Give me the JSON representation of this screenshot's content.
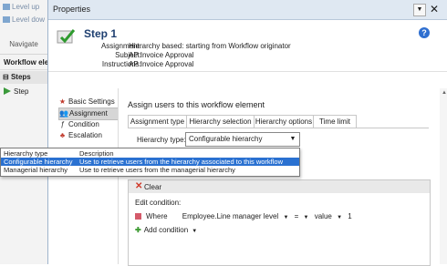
{
  "background_app": {
    "level_up": "Level up",
    "level_down": "Level dow",
    "navigate": "Navigate",
    "workflow_elements": "Workflow ele",
    "steps": "Steps",
    "step_item": "Step"
  },
  "dialog": {
    "title": "Properties",
    "header": {
      "step_title": "Step 1",
      "assignment_label": "Assignment:",
      "assignment_value": "Hierarchy based: starting from Workflow originator",
      "subject_label": "Subject:",
      "subject_value": "AP Invoice Approval",
      "instructions_label": "Instructions:",
      "instructions_value": "AP Invoice Approval"
    },
    "nav": [
      {
        "label": "Basic Settings"
      },
      {
        "label": "Assignment"
      },
      {
        "label": "Condition"
      },
      {
        "label": "Escalation"
      }
    ],
    "content": {
      "title": "Assign users to this workflow element",
      "tabs": [
        "Assignment type",
        "Hierarchy selection",
        "Hierarchy options",
        "Time limit"
      ],
      "hierarchy_type_label": "Hierarchy type:",
      "hierarchy_type_value": "Configurable hierarchy",
      "condition": {
        "clear_label": "Clear",
        "edit_condition": "Edit condition:",
        "where": "Where",
        "field": "Employee.Line manager level",
        "operator": "=",
        "value_type": "value",
        "value": "1",
        "add_condition": "Add condition"
      }
    }
  },
  "dropdown": {
    "header": {
      "col1": "Hierarchy type",
      "col2": "Description"
    },
    "rows": [
      {
        "col1": "Configurable hierarchy",
        "col2": "Use to retrieve users from the hierarchy associated to this workflow",
        "selected": true
      },
      {
        "col1": "Managerial hierarchy",
        "col2": "Use to retrieve users from the managerial hierarchy",
        "selected": false
      }
    ]
  },
  "colors": {
    "accent": "#2a71d1",
    "titlebar": "#dfe8f2",
    "step_title": "#1e3f70"
  }
}
